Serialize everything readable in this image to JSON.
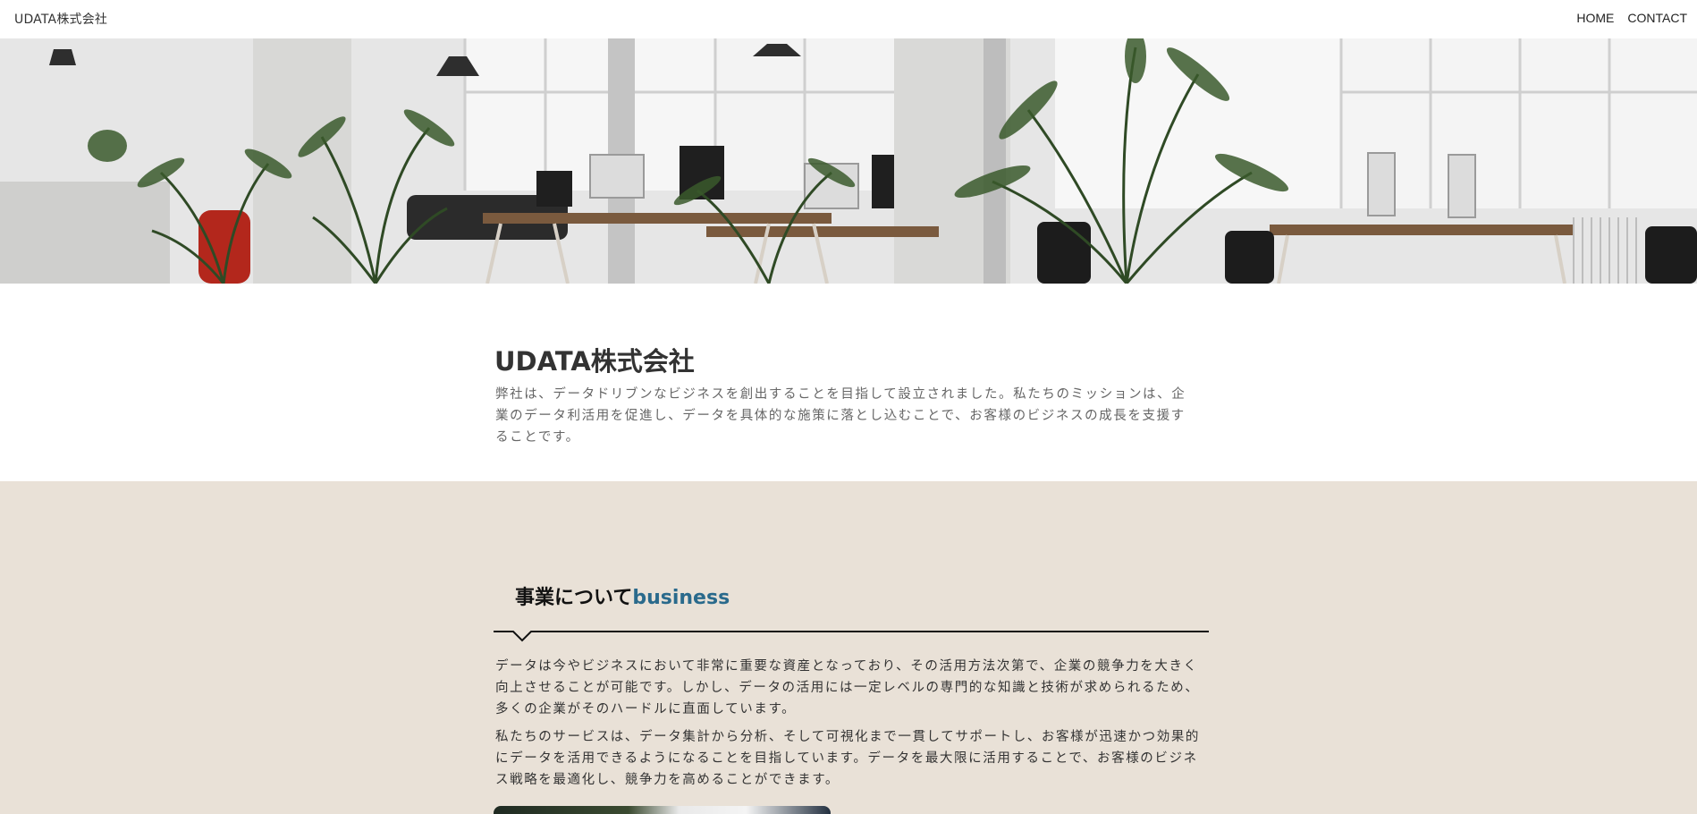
{
  "header": {
    "brand": "UDATA株式会社",
    "nav": [
      {
        "label": "HOME"
      },
      {
        "label": "CONTACT"
      }
    ]
  },
  "intro": {
    "title": "UDATA株式会社",
    "description": "弊社は、データドリブンなビジネスを創出することを目指して設立されました。私たちのミッションは、企業のデータ利活用を促進し、データを具体的な施策に落とし込むことで、お客様のビジネスの成長を支援することです。"
  },
  "business": {
    "heading_ja": "事業について",
    "heading_en": "business",
    "paragraphs": [
      "データは今やビジネスにおいて非常に重要な資産となっており、その活用方法次第で、企業の競争力を大きく向上させることが可能です。しかし、データの活用には一定レベルの専門的な知識と技術が求められるため、多くの企業がそのハードルに直面しています。",
      "私たちのサービスは、データ集計から分析、そして可視化まで一貫してサポートし、お客様が迅速かつ効果的にデータを活用できるようになることを目指しています。データを最大限に活用することで、お客様のビジネス戦略を最適化し、競争力を高めることができます。"
    ]
  },
  "colors": {
    "business_bg": "#e9e1d7",
    "accent": "#2a6a8c"
  }
}
